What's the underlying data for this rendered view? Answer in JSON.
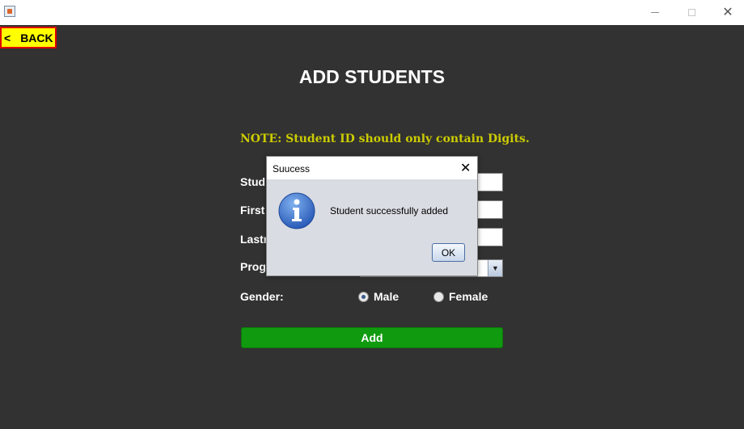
{
  "window": {
    "minimize_icon": "minimize-icon",
    "maximize_icon": "maximize-icon",
    "close_icon": "close-icon"
  },
  "back_button": {
    "chevron": "<",
    "label": "BACK"
  },
  "page_title": "ADD STUDENTS",
  "note": "NOTE: Student ID should only contain Digits.",
  "form": {
    "labels": {
      "student_id": "Stud",
      "first_name": "First",
      "last_name": "Lastn",
      "program": "Prog",
      "gender": "Gender:"
    },
    "gender_options": [
      {
        "label": "Male",
        "selected": true
      },
      {
        "label": "Female",
        "selected": false
      }
    ],
    "combo_arrow": "▼",
    "add_button": "Add"
  },
  "dialog": {
    "title": "Suucess",
    "close": "✕",
    "message": "Student successfully added",
    "ok_button": "OK",
    "icon": "information-icon"
  },
  "colors": {
    "background": "#323232",
    "note": "#cccc00",
    "back_button_bg": "#ffff00",
    "back_button_border": "#e00000",
    "add_button": "#0f9a0f"
  }
}
